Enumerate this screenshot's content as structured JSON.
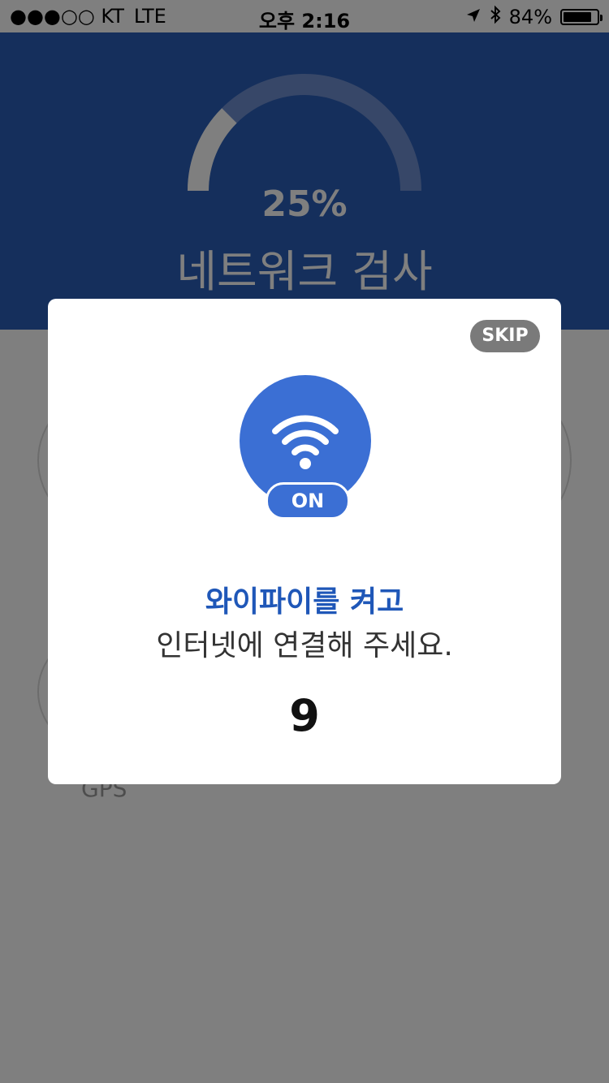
{
  "status_bar": {
    "carrier": "●●●○○ KT",
    "network": "LTE",
    "time": "오후 2:16",
    "battery": "84%",
    "battery_level": 0.84,
    "icons": [
      "location-arrow-icon",
      "bluetooth-icon",
      "battery-icon"
    ]
  },
  "header": {
    "progress_text": "25%",
    "progress_value": 0.25,
    "title": "네트워크 검사"
  },
  "background": {
    "gps_label": "GPS"
  },
  "modal": {
    "skip_label": "SKIP",
    "wifi_toggle_label": "ON",
    "icon": "wifi-icon",
    "title": "와이파이를 켜고",
    "body": "인터넷에 연결해 주세요.",
    "countdown": "9"
  },
  "colors": {
    "header_blue": "#2b5fb8",
    "accent_blue": "#3b6fd4",
    "title_blue": "#1f57b8",
    "skip_gray": "#7a7a7a"
  }
}
